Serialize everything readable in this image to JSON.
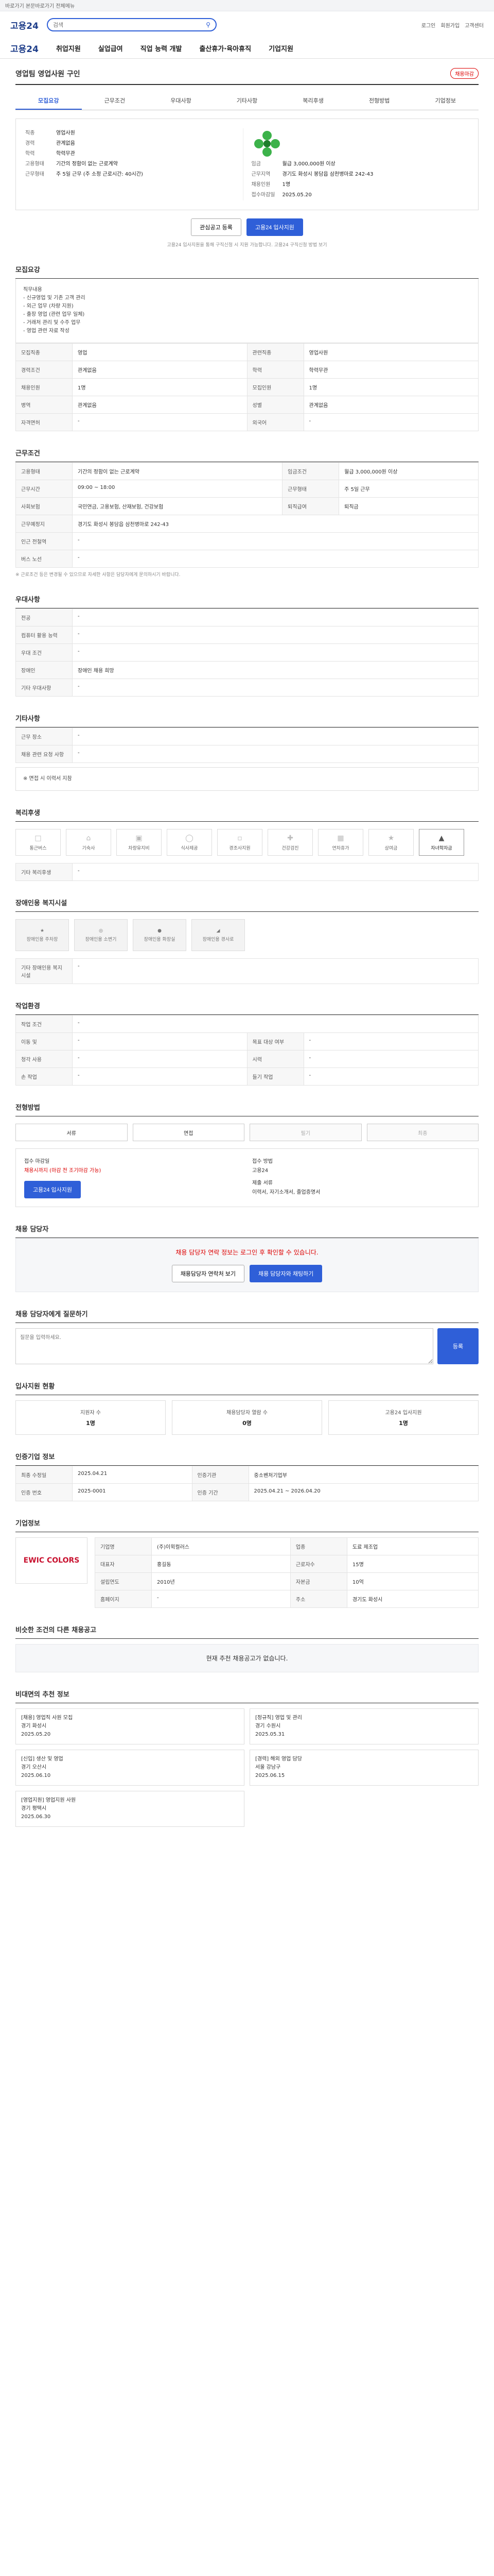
{
  "top": {
    "text": "바로가기 본문바로가기 전체메뉴"
  },
  "header": {
    "logo": "고용24",
    "search_placeholder": "검색",
    "links": [
      "로그인",
      "회원가입",
      "고객센터"
    ]
  },
  "gnb": {
    "logo": "고용24",
    "items": [
      "취업지원",
      "실업급여",
      "직업 능력 개발",
      "출산휴가·육아휴직",
      "기업지원"
    ]
  },
  "title": "영업팀 영업사원 구인",
  "badge": "채용마감",
  "tabs": [
    "모집요강",
    "근무조건",
    "우대사항",
    "기타사항",
    "복리후생",
    "전형방법",
    "기업정보"
  ],
  "summary": {
    "left": [
      [
        "직종",
        "영업사원"
      ],
      [
        "경력",
        "관계없음"
      ],
      [
        "학력",
        "학력무관"
      ],
      [
        "고용형태",
        "기간의 정함이 없는 근로계약"
      ],
      [
        "근무형태",
        "주 5일 근무 (주 소정 근로시간: 40시간)"
      ]
    ],
    "right": [
      [
        "임금",
        "월급 3,000,000원 이상"
      ],
      [
        "근무지역",
        "경기도 화성시 봉담읍 삼천병마로 242-43"
      ],
      [
        "채용인원",
        "1명"
      ],
      [
        "접수마감일",
        "2025.05.20"
      ]
    ]
  },
  "btn": {
    "fav": "관심공고 등록",
    "apply": "고용24 입사지원"
  },
  "note": "고용24 입사지원을 통해 구직신청 시 지원 가능합니다. 고용24 구직신청 방법 보기",
  "s1": {
    "h": "모집요강",
    "desc": [
      "직무내용",
      "- 신규영업 및 기존 고객 관리",
      "- 외근 업무 (차량 지원)",
      "- 출장 영업 (관련 업무 일체)",
      "- 거래처 관리 및 수주 업무",
      "- 영업 관련 자료 작성"
    ],
    "rows": [
      [
        "모집직종",
        "영업",
        "관련직종",
        "영업사원"
      ],
      [
        "경력조건",
        "관계없음",
        "학력",
        "학력무관"
      ],
      [
        "채용인원",
        "1명",
        "모집인원",
        "1명"
      ],
      [
        "병역",
        "관계없음",
        "성별",
        "관계없음"
      ],
      [
        "자격면허",
        "-",
        "외국어",
        "-"
      ]
    ]
  },
  "s2": {
    "h": "근무조건",
    "rows": [
      [
        "고용형태",
        "기간의 정함이 없는 근로계약",
        "임금조건",
        "월급 3,000,000원 이상"
      ],
      [
        "근무시간",
        "09:00 ~ 18:00",
        "근무형태",
        "주 5일 근무"
      ],
      [
        "사회보험",
        "국민연금, 고용보험, 산재보험, 건강보험",
        "퇴직급여",
        "퇴직금"
      ],
      [
        "근무예정지",
        "경기도 화성시 봉담읍 삼천병마로 242-43",
        "",
        ""
      ],
      [
        "인근 전철역",
        "-",
        "",
        ""
      ],
      [
        "버스 노선",
        "-",
        "",
        ""
      ]
    ],
    "note": "※ 근로조건 등은 변경될 수 있으므로 자세한 사항은 담당자에게 문의하시기 바랍니다."
  },
  "s3": {
    "h": "우대사항",
    "rows": [
      [
        "전공",
        "-"
      ],
      [
        "컴퓨터 활용 능력",
        "-"
      ],
      [
        "우대 조건",
        "-"
      ],
      [
        "장애인",
        "장애인 채용 희망"
      ],
      [
        "기타 우대사항",
        "-"
      ]
    ]
  },
  "s4": {
    "h": "기타사항",
    "rows": [
      [
        "근무 장소",
        "-"
      ],
      [
        "채용 관련 요청 사항",
        "-"
      ]
    ],
    "text": "※ 면접 시 이력서 지참"
  },
  "s5": {
    "h": "복리후생",
    "icons": [
      "통근버스",
      "기숙사",
      "차량유지비",
      "식사제공",
      "경조사지원",
      "건강검진",
      "연차휴가",
      "상여금",
      "자녀학자금"
    ],
    "on_index": 8,
    "text": "기타 복리후생",
    "val": "-"
  },
  "s6": {
    "h": "장애인용 복지시설",
    "icons": [
      "장애인용 주차장",
      "장애인용 소변기",
      "장애인용 화장실",
      "장애인용 경사로"
    ],
    "text": "기타 장애인용 복지시설",
    "val": "-"
  },
  "s7": {
    "h": "작업환경",
    "rows": [
      [
        "작업 조건",
        "-",
        "",
        ""
      ],
      [
        "이동 및",
        "-",
        "목표 대상 여부",
        "-"
      ],
      [
        "청각 사용",
        "-",
        "시력",
        "-"
      ],
      [
        "손 작업",
        "-",
        "들기 작업",
        "-"
      ]
    ]
  },
  "s8": {
    "h": "전형방법",
    "steps": [
      "서류",
      "면접",
      "필기",
      "최종"
    ],
    "labels": {
      "rec": "접수 마감일",
      "recv": "채용시까지 (마감 전 조기마감 가능)",
      "method": "접수 방법",
      "methodv": "고용24",
      "doc": "제출 서류",
      "docv": "이력서, 자기소개서, 졸업증명서"
    },
    "apply": "고용24 입사지원"
  },
  "s9": {
    "h": "채용 담당자",
    "warn": "채용 담당자 연락 정보는 로그인 후 확인할 수 있습니다.",
    "btn1": "채용담당자 연락처 보기",
    "btn2": "채용 담당자와 채팅하기"
  },
  "s10": {
    "h": "채용 담당자에게 질문하기",
    "placeholder": "질문을 입력하세요.",
    "submit": "등록"
  },
  "s11": {
    "h": "입사지원 현황",
    "stats": [
      [
        "지원자 수",
        "1명"
      ],
      [
        "채용담당자 열람 수",
        "0명"
      ],
      [
        "고용24 입사지원",
        "1명"
      ]
    ]
  },
  "s12": {
    "h": "인증기업 정보",
    "rows": [
      [
        "최종 수정일",
        "2025.04.21",
        "인증기관",
        "중소벤처기업부"
      ],
      [
        "인증 번호",
        "2025-0001",
        "인증 기간",
        "2025.04.21 ~ 2026.04.20"
      ]
    ]
  },
  "s13": {
    "h": "기업정보",
    "company": "EWIC COLORS",
    "rows": [
      [
        "기업명",
        "(주)이윅컬러스",
        "업종",
        "도료 제조업"
      ],
      [
        "대표자",
        "홍길동",
        "근로자수",
        "15명"
      ],
      [
        "설립연도",
        "2010년",
        "자본금",
        "10억"
      ],
      [
        "홈페이지",
        "-",
        "주소",
        "경기도 화성시"
      ]
    ]
  },
  "s14": {
    "h": "비슷한 조건의 다른 채용공고",
    "empty": "현재 추천 채용공고가 없습니다."
  },
  "s15": {
    "h": "비대면의 추천 정보",
    "cards": [
      [
        "[채용] 영업직 사원 모집",
        "경기 화성시",
        "2025.05.20"
      ],
      [
        "[정규직] 영업 및 관리",
        "경기 수원시",
        "2025.05.31"
      ],
      [
        "[신입] 생산 및 영업",
        "경기 오산시",
        "2025.06.10"
      ],
      [
        "[경력] 해외 영업 담당",
        "서울 강남구",
        "2025.06.15"
      ],
      [
        "[영업지원] 영업지원 사원",
        "경기 평택시",
        "2025.06.30"
      ]
    ]
  }
}
